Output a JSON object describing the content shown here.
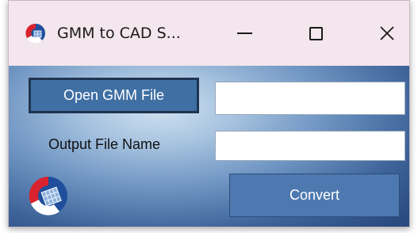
{
  "window": {
    "title": "GMM to CAD S...",
    "controls": {
      "minimize_icon": "minimize-icon",
      "maximize_icon": "maximize-icon",
      "close_icon": "close-icon",
      "close_glyph": "✕"
    }
  },
  "form": {
    "open_button_label": "Open GMM File",
    "gmm_file_value": "",
    "output_label": "Output File Name",
    "output_file_value": "",
    "convert_button_label": "Convert"
  },
  "colors": {
    "titlebar_bg": "#f3e6ec",
    "client_gradient_light": "#cfe0f0",
    "client_gradient_dark": "#2a4b80",
    "button_bg": "#3f6fa3",
    "logo_red": "#d9232e",
    "logo_blue": "#1f4f9c"
  },
  "icons": {
    "app": "gmm-app-icon",
    "logo": "gmm-logo-icon"
  }
}
